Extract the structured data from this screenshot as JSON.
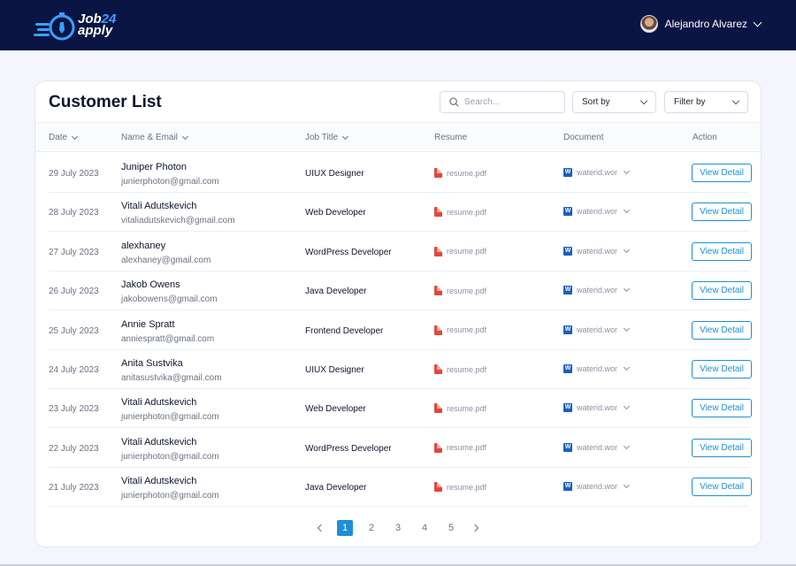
{
  "app": {
    "logo_line1": "Job",
    "logo_num": "24",
    "logo_line2": "apply",
    "user_name": "Alejandro Alvarez"
  },
  "colors": {
    "topbar": "#0a1543",
    "accent": "#1f8fd6",
    "pdf": "#e2483b",
    "word": "#1c5fbf"
  },
  "page": {
    "title": "Customer List",
    "search_placeholder": "Search...",
    "sort_label": "Sort by",
    "filter_label": "Filter by"
  },
  "table": {
    "headers": {
      "date": "Date",
      "name": "Name & Email",
      "job": "Job Title",
      "resume": "Resume",
      "document": "Document",
      "action": "Action"
    },
    "rows": [
      {
        "date": "29 July 2023",
        "name": "Juniper Photon",
        "email": "junierphoton@gmail.com",
        "job": "UIUX Designer",
        "resume": "resume.pdf",
        "document": "waterid.wor",
        "action": "View Detail"
      },
      {
        "date": "28 July 2023",
        "name": "Vitali Adutskevich",
        "email": "vitaliadutskevich@gmail.com",
        "job": "Web Developer",
        "resume": "resume.pdf",
        "document": "waterid.wor",
        "action": "View Detail"
      },
      {
        "date": "27 July 2023",
        "name": "alexhaney",
        "email": "alexhaney@gmail.com",
        "job": "WordPress Developer",
        "resume": "resume.pdf",
        "document": "waterid.wor",
        "action": "View Detail"
      },
      {
        "date": "26 July 2023",
        "name": "Jakob Owens",
        "email": "jakobowens@gmail.com",
        "job": "Java Developer",
        "resume": "resume.pdf",
        "document": "waterid.wor",
        "action": "View Detail"
      },
      {
        "date": "25 July 2023",
        "name": "Annie Spratt",
        "email": "anniespratt@gmail.com",
        "job": "Frontend Developer",
        "resume": "resume.pdf",
        "document": "waterid.wor",
        "action": "View Detail"
      },
      {
        "date": "24 July 2023",
        "name": "Anita Sustvika",
        "email": "anitasustvika@gmail.com",
        "job": "UIUX Designer",
        "resume": "resume.pdf",
        "document": "waterid.wor",
        "action": "View Detail"
      },
      {
        "date": "23 July 2023",
        "name": "Vitali Adutskevich",
        "email": "junierphoton@gmail.com",
        "job": "Web Developer",
        "resume": "resume.pdf",
        "document": "waterid.wor",
        "action": "View Detail"
      },
      {
        "date": "22 July 2023",
        "name": "Vitali Adutskevich",
        "email": "junierphoton@gmail.com",
        "job": "WordPress Developer",
        "resume": "resume.pdf",
        "document": "waterid.wor",
        "action": "View Detail"
      },
      {
        "date": "21 July 2023",
        "name": "Vitali Adutskevich",
        "email": "junierphoton@gmail.com",
        "job": "Java Developer",
        "resume": "resume.pdf",
        "document": "waterid.wor",
        "action": "View Detail"
      }
    ]
  },
  "pagination": {
    "pages": [
      "1",
      "2",
      "3",
      "4",
      "5"
    ],
    "current": "1"
  }
}
